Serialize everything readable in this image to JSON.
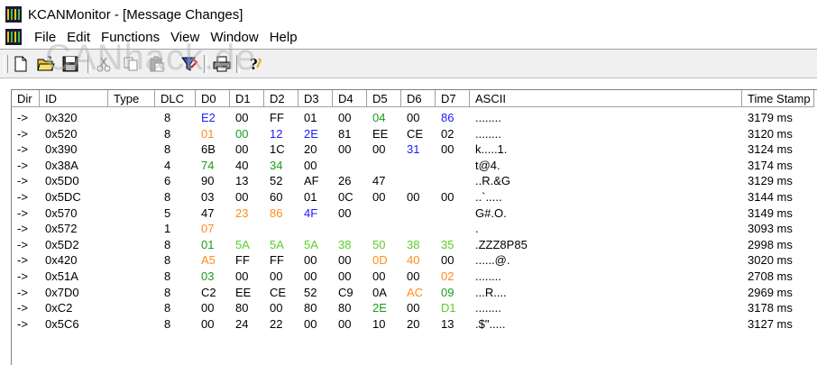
{
  "window": {
    "title": "KCANMonitor - [Message Changes]"
  },
  "menu": [
    "File",
    "Edit",
    "Functions",
    "View",
    "Window",
    "Help"
  ],
  "watermark": "CANhack.de",
  "toolbar_icons": [
    "new-file-icon",
    "open-folder-icon",
    "save-icon",
    "cut-icon",
    "copy-icon",
    "paste-icon",
    "filter-icon",
    "print-icon",
    "help-icon"
  ],
  "colors": {
    "blue": "#1c1cff",
    "orange": "#ff8c1a",
    "green": "#1a9c1a",
    "lime": "#5ccc2c",
    "black": "#000000"
  },
  "columns": [
    "Dir",
    "ID",
    "Type",
    "DLC",
    "D0",
    "D1",
    "D2",
    "D3",
    "D4",
    "D5",
    "D6",
    "D7",
    "ASCII",
    "Time Stamp"
  ],
  "rows": [
    {
      "dir": "->",
      "id": "0x320",
      "type": "",
      "dlc": "8",
      "bytes": [
        [
          "E2",
          "blue"
        ],
        [
          "00",
          "black"
        ],
        [
          "FF",
          "black"
        ],
        [
          "01",
          "black"
        ],
        [
          "00",
          "black"
        ],
        [
          "04",
          "green"
        ],
        [
          "00",
          "black"
        ],
        [
          "86",
          "blue"
        ]
      ],
      "ascii": "........",
      "ts": "3179 ms"
    },
    {
      "dir": "->",
      "id": "0x520",
      "type": "",
      "dlc": "8",
      "bytes": [
        [
          "01",
          "orange"
        ],
        [
          "00",
          "green"
        ],
        [
          "12",
          "blue"
        ],
        [
          "2E",
          "blue"
        ],
        [
          "81",
          "black"
        ],
        [
          "EE",
          "black"
        ],
        [
          "CE",
          "black"
        ],
        [
          "02",
          "black"
        ]
      ],
      "ascii": "........",
      "ts": "3120 ms"
    },
    {
      "dir": "->",
      "id": "0x390",
      "type": "",
      "dlc": "8",
      "bytes": [
        [
          "6B",
          "black"
        ],
        [
          "00",
          "black"
        ],
        [
          "1C",
          "black"
        ],
        [
          "20",
          "black"
        ],
        [
          "00",
          "black"
        ],
        [
          "00",
          "black"
        ],
        [
          "31",
          "blue"
        ],
        [
          "00",
          "black"
        ]
      ],
      "ascii": "k.....1.",
      "ts": "3124 ms"
    },
    {
      "dir": "->",
      "id": "0x38A",
      "type": "",
      "dlc": "4",
      "bytes": [
        [
          "74",
          "green"
        ],
        [
          "40",
          "black"
        ],
        [
          "34",
          "green"
        ],
        [
          "00",
          "black"
        ],
        [
          "",
          ""
        ],
        [
          "",
          ""
        ],
        [
          "",
          ""
        ],
        [
          "",
          ""
        ]
      ],
      "ascii": "t@4.",
      "ts": "3174 ms"
    },
    {
      "dir": "->",
      "id": "0x5D0",
      "type": "",
      "dlc": "6",
      "bytes": [
        [
          "90",
          "black"
        ],
        [
          "13",
          "black"
        ],
        [
          "52",
          "black"
        ],
        [
          "AF",
          "black"
        ],
        [
          "26",
          "black"
        ],
        [
          "47",
          "black"
        ],
        [
          "",
          ""
        ],
        [
          "",
          ""
        ]
      ],
      "ascii": "..R.&G",
      "ts": "3129 ms"
    },
    {
      "dir": "->",
      "id": "0x5DC",
      "type": "",
      "dlc": "8",
      "bytes": [
        [
          "03",
          "black"
        ],
        [
          "00",
          "black"
        ],
        [
          "60",
          "black"
        ],
        [
          "01",
          "black"
        ],
        [
          "0C",
          "black"
        ],
        [
          "00",
          "black"
        ],
        [
          "00",
          "black"
        ],
        [
          "00",
          "black"
        ]
      ],
      "ascii": "..`.....",
      "ts": "3144 ms"
    },
    {
      "dir": "->",
      "id": "0x570",
      "type": "",
      "dlc": "5",
      "bytes": [
        [
          "47",
          "black"
        ],
        [
          "23",
          "orange"
        ],
        [
          "86",
          "orange"
        ],
        [
          "4F",
          "blue"
        ],
        [
          "00",
          "black"
        ],
        [
          "",
          ""
        ],
        [
          "",
          ""
        ],
        [
          "",
          ""
        ]
      ],
      "ascii": "G#.O.",
      "ts": "3149 ms"
    },
    {
      "dir": "->",
      "id": "0x572",
      "type": "",
      "dlc": "1",
      "bytes": [
        [
          "07",
          "orange"
        ],
        [
          "",
          ""
        ],
        [
          "",
          ""
        ],
        [
          "",
          ""
        ],
        [
          "",
          ""
        ],
        [
          "",
          ""
        ],
        [
          "",
          ""
        ],
        [
          "",
          ""
        ]
      ],
      "ascii": ".",
      "ts": "3093 ms"
    },
    {
      "dir": "->",
      "id": "0x5D2",
      "type": "",
      "dlc": "8",
      "bytes": [
        [
          "01",
          "green"
        ],
        [
          "5A",
          "lime"
        ],
        [
          "5A",
          "lime"
        ],
        [
          "5A",
          "lime"
        ],
        [
          "38",
          "lime"
        ],
        [
          "50",
          "lime"
        ],
        [
          "38",
          "lime"
        ],
        [
          "35",
          "lime"
        ]
      ],
      "ascii": ".ZZZ8P85",
      "ts": "2998 ms"
    },
    {
      "dir": "->",
      "id": "0x420",
      "type": "",
      "dlc": "8",
      "bytes": [
        [
          "A5",
          "orange"
        ],
        [
          "FF",
          "black"
        ],
        [
          "FF",
          "black"
        ],
        [
          "00",
          "black"
        ],
        [
          "00",
          "black"
        ],
        [
          "0D",
          "orange"
        ],
        [
          "40",
          "orange"
        ],
        [
          "00",
          "black"
        ]
      ],
      "ascii": "......@.",
      "ts": "3020 ms"
    },
    {
      "dir": "->",
      "id": "0x51A",
      "type": "",
      "dlc": "8",
      "bytes": [
        [
          "03",
          "green"
        ],
        [
          "00",
          "black"
        ],
        [
          "00",
          "black"
        ],
        [
          "00",
          "black"
        ],
        [
          "00",
          "black"
        ],
        [
          "00",
          "black"
        ],
        [
          "00",
          "black"
        ],
        [
          "02",
          "orange"
        ]
      ],
      "ascii": "........",
      "ts": "2708 ms"
    },
    {
      "dir": "->",
      "id": "0x7D0",
      "type": "",
      "dlc": "8",
      "bytes": [
        [
          "C2",
          "black"
        ],
        [
          "EE",
          "black"
        ],
        [
          "CE",
          "black"
        ],
        [
          "52",
          "black"
        ],
        [
          "C9",
          "black"
        ],
        [
          "0A",
          "black"
        ],
        [
          "AC",
          "orange"
        ],
        [
          "09",
          "green"
        ]
      ],
      "ascii": "...R....",
      "ts": "2969 ms"
    },
    {
      "dir": "->",
      "id": "0xC2",
      "type": "",
      "dlc": "8",
      "bytes": [
        [
          "00",
          "black"
        ],
        [
          "80",
          "black"
        ],
        [
          "00",
          "black"
        ],
        [
          "80",
          "black"
        ],
        [
          "80",
          "black"
        ],
        [
          "2E",
          "green"
        ],
        [
          "00",
          "black"
        ],
        [
          "D1",
          "lime"
        ]
      ],
      "ascii": "........",
      "ts": "3178 ms"
    },
    {
      "dir": "->",
      "id": "0x5C6",
      "type": "",
      "dlc": "8",
      "bytes": [
        [
          "00",
          "black"
        ],
        [
          "24",
          "black"
        ],
        [
          "22",
          "black"
        ],
        [
          "00",
          "black"
        ],
        [
          "00",
          "black"
        ],
        [
          "10",
          "black"
        ],
        [
          "20",
          "black"
        ],
        [
          "13",
          "black"
        ]
      ],
      "ascii": ".$\".....",
      "ts": "3127 ms"
    }
  ]
}
